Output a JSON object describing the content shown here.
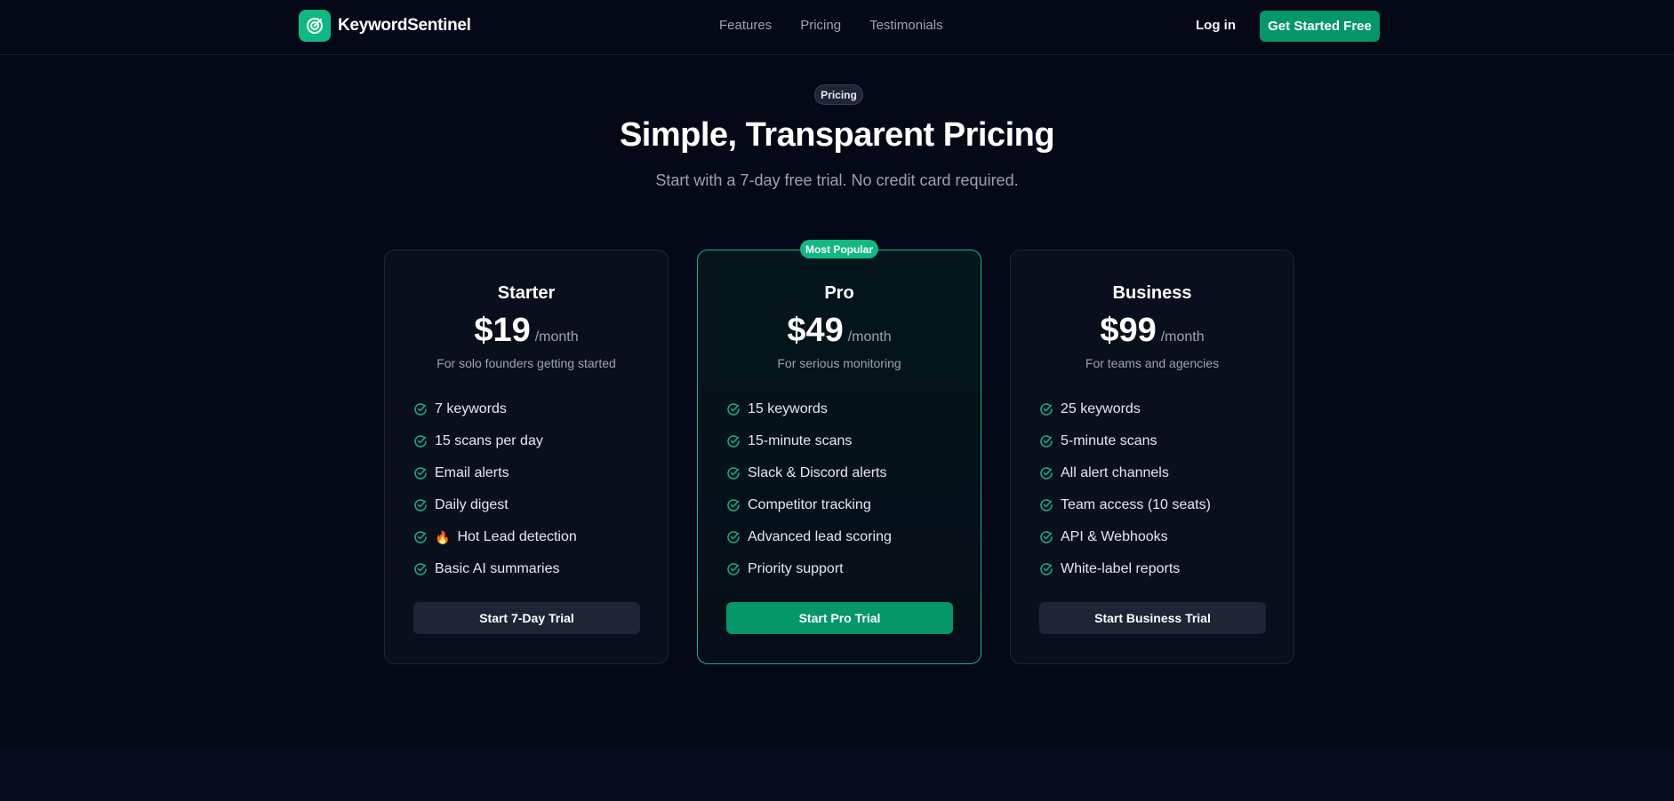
{
  "brand": {
    "name": "KeywordSentinel",
    "logo_icon": "target-icon",
    "accent": "#10b981"
  },
  "nav": {
    "links": [
      "Features",
      "Pricing",
      "Testimonials"
    ],
    "login": "Log in",
    "cta": "Get Started Free"
  },
  "hero": {
    "pill": "Pricing",
    "title": "Simple, Transparent Pricing",
    "subtitle": "Start with a 7-day free trial. No credit card required."
  },
  "plans": [
    {
      "name": "Starter",
      "price": "$19",
      "period": "/month",
      "description": "For solo founders getting started",
      "features": [
        "7 keywords",
        "15 scans per day",
        "Email alerts",
        "Daily digest",
        "Hot Lead detection",
        "Basic AI summaries"
      ],
      "fire_feature_emoji": "🔥",
      "button": "Start 7-Day Trial"
    },
    {
      "name": "Pro",
      "badge": "Most Popular",
      "price": "$49",
      "period": "/month",
      "description": "For serious monitoring",
      "features": [
        "15 keywords",
        "15-minute scans",
        "Slack & Discord alerts",
        "Competitor tracking",
        "Advanced lead scoring",
        "Priority support"
      ],
      "button": "Start Pro Trial"
    },
    {
      "name": "Business",
      "price": "$99",
      "period": "/month",
      "description": "For teams and agencies",
      "features": [
        "25 keywords",
        "5-minute scans",
        "All alert channels",
        "Team access (10 seats)",
        "API & Webhooks",
        "White-label reports"
      ],
      "button": "Start Business Trial"
    }
  ],
  "colors": {
    "background": "#050816",
    "card": "#0a0f1e",
    "primary_button": "#059669",
    "check": "#10b981"
  }
}
